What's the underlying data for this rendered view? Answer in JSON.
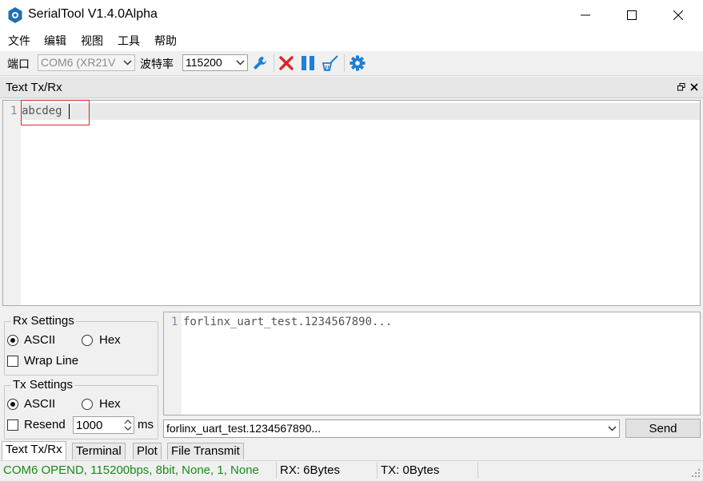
{
  "window": {
    "title": "SerialTool V1.4.0Alpha"
  },
  "menu": [
    "文件",
    "编辑",
    "视图",
    "工具",
    "帮助"
  ],
  "toolbar": {
    "port_label": "端口",
    "port_value": "COM6 (XR21V",
    "baud_label": "波特率",
    "baud_value": "115200"
  },
  "panel": {
    "title": "Text Tx/Rx"
  },
  "rx_editor": {
    "line_number": "1",
    "text": "abcdeg"
  },
  "rx_settings": {
    "title": "Rx Settings",
    "ascii": "ASCII",
    "hex": "Hex",
    "wrap_line": "Wrap Line",
    "mode": "ASCII",
    "wrap_checked": false
  },
  "tx_settings": {
    "title": "Tx Settings",
    "ascii": "ASCII",
    "hex": "Hex",
    "resend": "Resend",
    "interval": "1000",
    "unit": "ms",
    "mode": "ASCII",
    "resend_checked": false
  },
  "tx_editor": {
    "line_number": "1",
    "text": "forlinx_uart_test.1234567890..."
  },
  "send": {
    "history_value": "forlinx_uart_test.1234567890...",
    "button": "Send"
  },
  "tabs": [
    {
      "label": "Text Tx/Rx",
      "active": true
    },
    {
      "label": "Terminal",
      "active": false
    },
    {
      "label": "Plot",
      "active": false
    },
    {
      "label": "File Transmit",
      "active": false
    }
  ],
  "status": {
    "connection": "COM6 OPEND, 115200bps, 8bit, None, 1, None",
    "rx": "RX: 6Bytes",
    "tx": "TX: 0Bytes",
    "connection_color": "#1a8a1a"
  },
  "colors": {
    "accent_blue": "#1e7fd6",
    "close_red": "#d9262b",
    "highlight_box": "#d9262b"
  },
  "icons": [
    "app-icon",
    "minimize-icon",
    "maximize-icon",
    "close-icon",
    "wrench-icon",
    "disconnect-icon",
    "pause-icon",
    "clear-icon",
    "settings-icon",
    "float-icon",
    "chevron-down-icon"
  ]
}
